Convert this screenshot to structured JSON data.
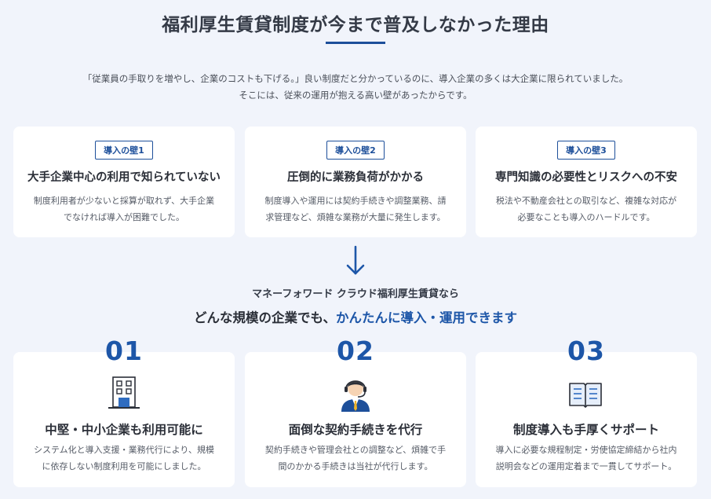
{
  "title": "福利厚生賃貸制度が今まで普及しなかった理由",
  "intro": {
    "line1": "「従業員の手取りを増やし、企業のコストも下げる。」良い制度だと分かっているのに、導入企業の多くは大企業に限られていました。",
    "line2": "そこには、従来の運用が抱える高い壁があったからです。"
  },
  "walls": [
    {
      "badge": "導入の壁1",
      "heading": "大手企業中心の利用で知られていない",
      "body": "制度利用者が少ないと採算が取れず、大手企業でなければ導入が困難でした。"
    },
    {
      "badge": "導入の壁2",
      "heading": "圧倒的に業務負荷がかかる",
      "body": "制度導入や運用には契約手続きや調整業務、請求管理など、煩雑な業務が大量に発生します。"
    },
    {
      "badge": "導入の壁3",
      "heading": "専門知識の必要性とリスクへの不安",
      "body": "税法や不動産会社との取引など、複雑な対応が必要なことも導入のハードルです。"
    }
  ],
  "arrow_icon": "arrow-down-icon",
  "solution": {
    "line1": "マネーフォワード クラウド福利厚生賃貸なら",
    "line2_plain": "どんな規模の企業でも、",
    "line2_accent": "かんたんに導入・運用できます"
  },
  "features": [
    {
      "number": "01",
      "icon": "building-icon",
      "heading": "中堅・中小企業も利用可能に",
      "body": "システム化と導入支援・業務代行により、規模に依存しない制度利用を可能にしました。"
    },
    {
      "number": "02",
      "icon": "operator-headset-icon",
      "heading": "面倒な契約手続きを代行",
      "body": "契約手続きや管理会社との調整など、煩雑で手間のかかる手続きは当社が代行します。"
    },
    {
      "number": "03",
      "icon": "open-book-icon",
      "heading": "制度導入も手厚くサポート",
      "body": "導入に必要な規程制定・労使協定締結から社内説明会などの運用定着まで一貫してサポート。"
    }
  ],
  "colors": {
    "accent": "#1d56a8",
    "background": "#f1f4fb",
    "card": "#ffffff",
    "text": "#2b2f38"
  }
}
